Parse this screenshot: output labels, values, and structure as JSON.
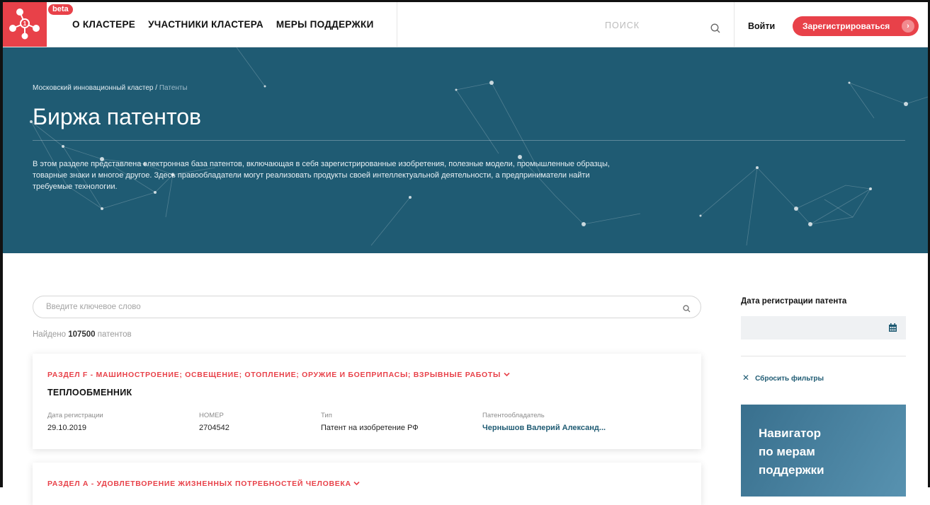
{
  "header": {
    "beta_label": "beta",
    "nav": [
      "О КЛАСТЕРЕ",
      "УЧАСТНИКИ КЛАСТЕРА",
      "МЕРЫ ПОДДЕРЖКИ"
    ],
    "search_label": "ПОИСК",
    "login_label": "Войти",
    "register_label": "Зарегистрироваться",
    "brand_color": "#e84149"
  },
  "hero": {
    "breadcrumb_root": "Московский инновационный кластер",
    "breadcrumb_sep": " / ",
    "breadcrumb_current": "Патенты",
    "title": "Биржа патентов",
    "description": "В этом разделе представлена электронная база патентов, включающая в себя зарегистрированные изобретения, полезные модели, промышленные образцы, товарные знаки и многое другое. Здесь правообладатели могут реализовать продукты своей интеллектуальной деятельности, а предприниматели найти требуемые технологии.",
    "bg_color": "#1f5b73"
  },
  "search": {
    "placeholder": "Введите ключевое слово",
    "found_prefix": "Найдено",
    "found_count": "107500",
    "found_suffix": "патентов"
  },
  "patents": [
    {
      "section": "РАЗДЕЛ F - МАШИНОСТРОЕНИЕ; ОСВЕЩЕНИЕ; ОТОПЛЕНИЕ; ОРУЖИЕ И БОЕПРИПАСЫ; ВЗРЫВНЫЕ РАБОТЫ",
      "title": "ТЕПЛООБМЕННИК",
      "fields": [
        {
          "label": "Дата регистрации",
          "value": "29.10.2019"
        },
        {
          "label": "НОМЕР",
          "value": "2704542"
        },
        {
          "label": "Тип",
          "value": "Патент на изобретение РФ"
        },
        {
          "label": "Патентообладатель",
          "value": "Чернышов Валерий Александ..."
        }
      ]
    },
    {
      "section": "РАЗДЕЛ А - УДОВЛЕТВОРЕНИЕ ЖИЗНЕННЫХ ПОТРЕБНОСТЕЙ ЧЕЛОВЕКА"
    }
  ],
  "sidebar": {
    "date_heading": "Дата регистрации патента",
    "reset_label": "Сбросить фильтры",
    "promo_lines": [
      "Навигатор",
      "по мерам",
      "поддержки"
    ]
  },
  "icons": {
    "logo": "network-logo-icon",
    "search": "search-icon",
    "arrow": "chevron-right-icon",
    "dropdown": "chevron-down-icon",
    "calendar": "calendar-icon",
    "close": "close-icon"
  }
}
